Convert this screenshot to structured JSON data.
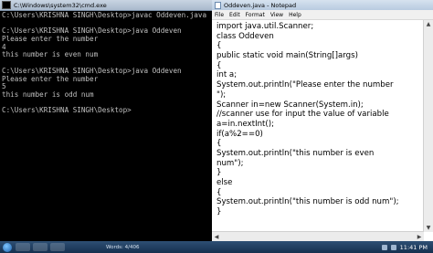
{
  "cmd": {
    "title": "C:\\Windows\\system32\\cmd.exe",
    "lines": [
      "C:\\Users\\KRISHNA SINGH\\Desktop>javac Oddeven.java",
      "",
      "C:\\Users\\KRISHNA SINGH\\Desktop>java Oddeven",
      "Please enter the number",
      "4",
      "this number is even num",
      "",
      "C:\\Users\\KRISHNA SINGH\\Desktop>java Oddeven",
      "Please enter the number",
      "5",
      "this number is odd num",
      "",
      "C:\\Users\\KRISHNA SINGH\\Desktop>"
    ]
  },
  "notepad": {
    "title": "Oddeven.java - Notepad",
    "menu": [
      "File",
      "Edit",
      "Format",
      "View",
      "Help"
    ],
    "lines": [
      "import java.util.Scanner;",
      "class Oddeven",
      "{",
      "public static void main(String[]args)",
      "{",
      "int a;",
      "System.out.println(\"Please enter the number",
      "\");",
      "Scanner in=new Scanner(System.in);",
      "//scanner use for input the value of variable",
      "a=in.nextInt();",
      "if(a%2==0)",
      "{",
      "System.out.println(\"this number is even",
      "num\");",
      "}",
      "else",
      "{",
      "System.out.println(\"this number is odd num\");",
      "}"
    ]
  },
  "taskbar": {
    "status": "Words: 4/406",
    "clock": "11:41 PM"
  }
}
